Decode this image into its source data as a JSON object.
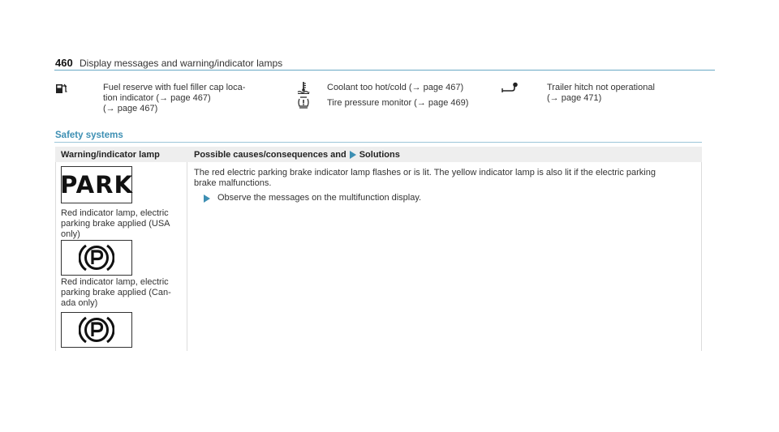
{
  "header": {
    "page_number": "460",
    "title": "Display messages and warning/indicator lamps"
  },
  "top_items": [
    {
      "icon": "fuel-pump-icon",
      "lines": [
        "Fuel reserve with fuel filler cap loca-",
        "tion indicator (→ page 467)",
        "(→ page 467)"
      ]
    },
    {
      "icon": "coolant-temperature-icon",
      "text": "Coolant too hot/cold (→ page 467)"
    },
    {
      "icon": "tire-pressure-icon",
      "text": "Tire pressure monitor (→ page 469)"
    },
    {
      "icon": "trailer-hitch-icon",
      "lines": [
        "Trailer hitch not operational",
        "(→ page 471)"
      ]
    }
  ],
  "section": {
    "title": "Safety systems",
    "table": {
      "col1_header": "Warning/indicator lamp",
      "col2_header_a": "Possible causes/consequences and",
      "col2_header_b": "Solutions",
      "lamps": [
        {
          "symbol": "PARK",
          "caption_lines": [
            "Red indicator lamp, electric",
            "parking brake applied (USA",
            "only)"
          ]
        },
        {
          "symbol": "(P)",
          "caption_lines": [
            "Red indicator lamp, electric",
            "parking brake applied (Can-",
            "ada only)"
          ]
        },
        {
          "symbol": "(P)"
        }
      ],
      "description_lines": [
        "The red electric parking brake indicator lamp flashes or is lit. The yellow indicator lamp is also lit if the electric parking",
        "brake malfunctions."
      ],
      "action": "Observe the messages on the multifunction display."
    }
  },
  "colors": {
    "accent": "#3d8fb3",
    "header_line": "#6aa8c4",
    "table_header_bg": "#eeeeee"
  }
}
